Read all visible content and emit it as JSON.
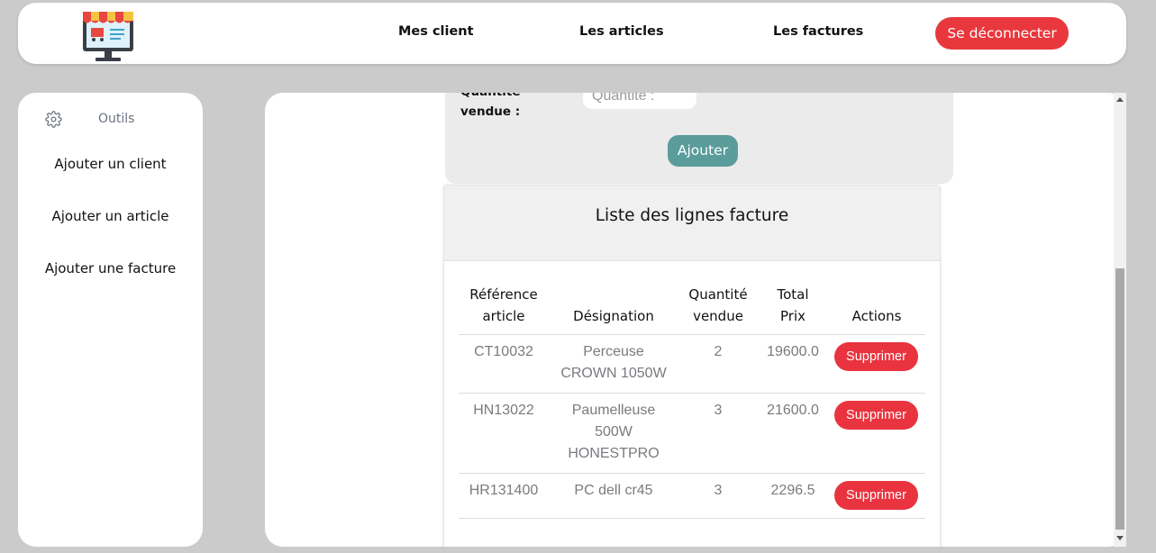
{
  "header": {
    "logo_icon": "shop-monitor-logo-icon",
    "nav": [
      {
        "label": "Mes client"
      },
      {
        "label": "Les articles"
      },
      {
        "label": "Les factures"
      }
    ],
    "logout_label": "Se déconnecter"
  },
  "sidebar": {
    "tools_icon": "gear-icon",
    "tools_label": "Outils",
    "items": [
      {
        "label": "Ajouter un client"
      },
      {
        "label": "Ajouter un article"
      },
      {
        "label": "Ajouter une facture"
      }
    ]
  },
  "form": {
    "qty_label_line1": "Quantité",
    "qty_label_line2": "vendue :",
    "qty_placeholder": "Quantité :",
    "add_label": "Ajouter"
  },
  "list": {
    "title": "Liste des lignes facture",
    "columns": [
      {
        "l1": "Référence",
        "l2": "article"
      },
      {
        "l1": "",
        "l2": "Désignation"
      },
      {
        "l1": "Quantité",
        "l2": "vendue"
      },
      {
        "l1": "Total",
        "l2": "Prix"
      },
      {
        "l1": "",
        "l2": "Actions"
      }
    ],
    "rows": [
      {
        "ref": "CT10032",
        "des": [
          "Perceuse",
          "CROWN 1050W"
        ],
        "qty": "2",
        "total": "19600.0",
        "action": "Supprimer"
      },
      {
        "ref": "HN13022",
        "des": [
          "Paumelleuse",
          "500W",
          "HONESTPRO"
        ],
        "qty": "3",
        "total": "21600.0",
        "action": "Supprimer"
      },
      {
        "ref": "HR131400",
        "des": [
          "PC dell cr45"
        ],
        "qty": "3",
        "total": "2296.5",
        "action": "Supprimer"
      }
    ]
  },
  "colors": {
    "logout": "#e8383d",
    "add_button": "#5a9c9a",
    "delete_button": "#e9343f"
  }
}
